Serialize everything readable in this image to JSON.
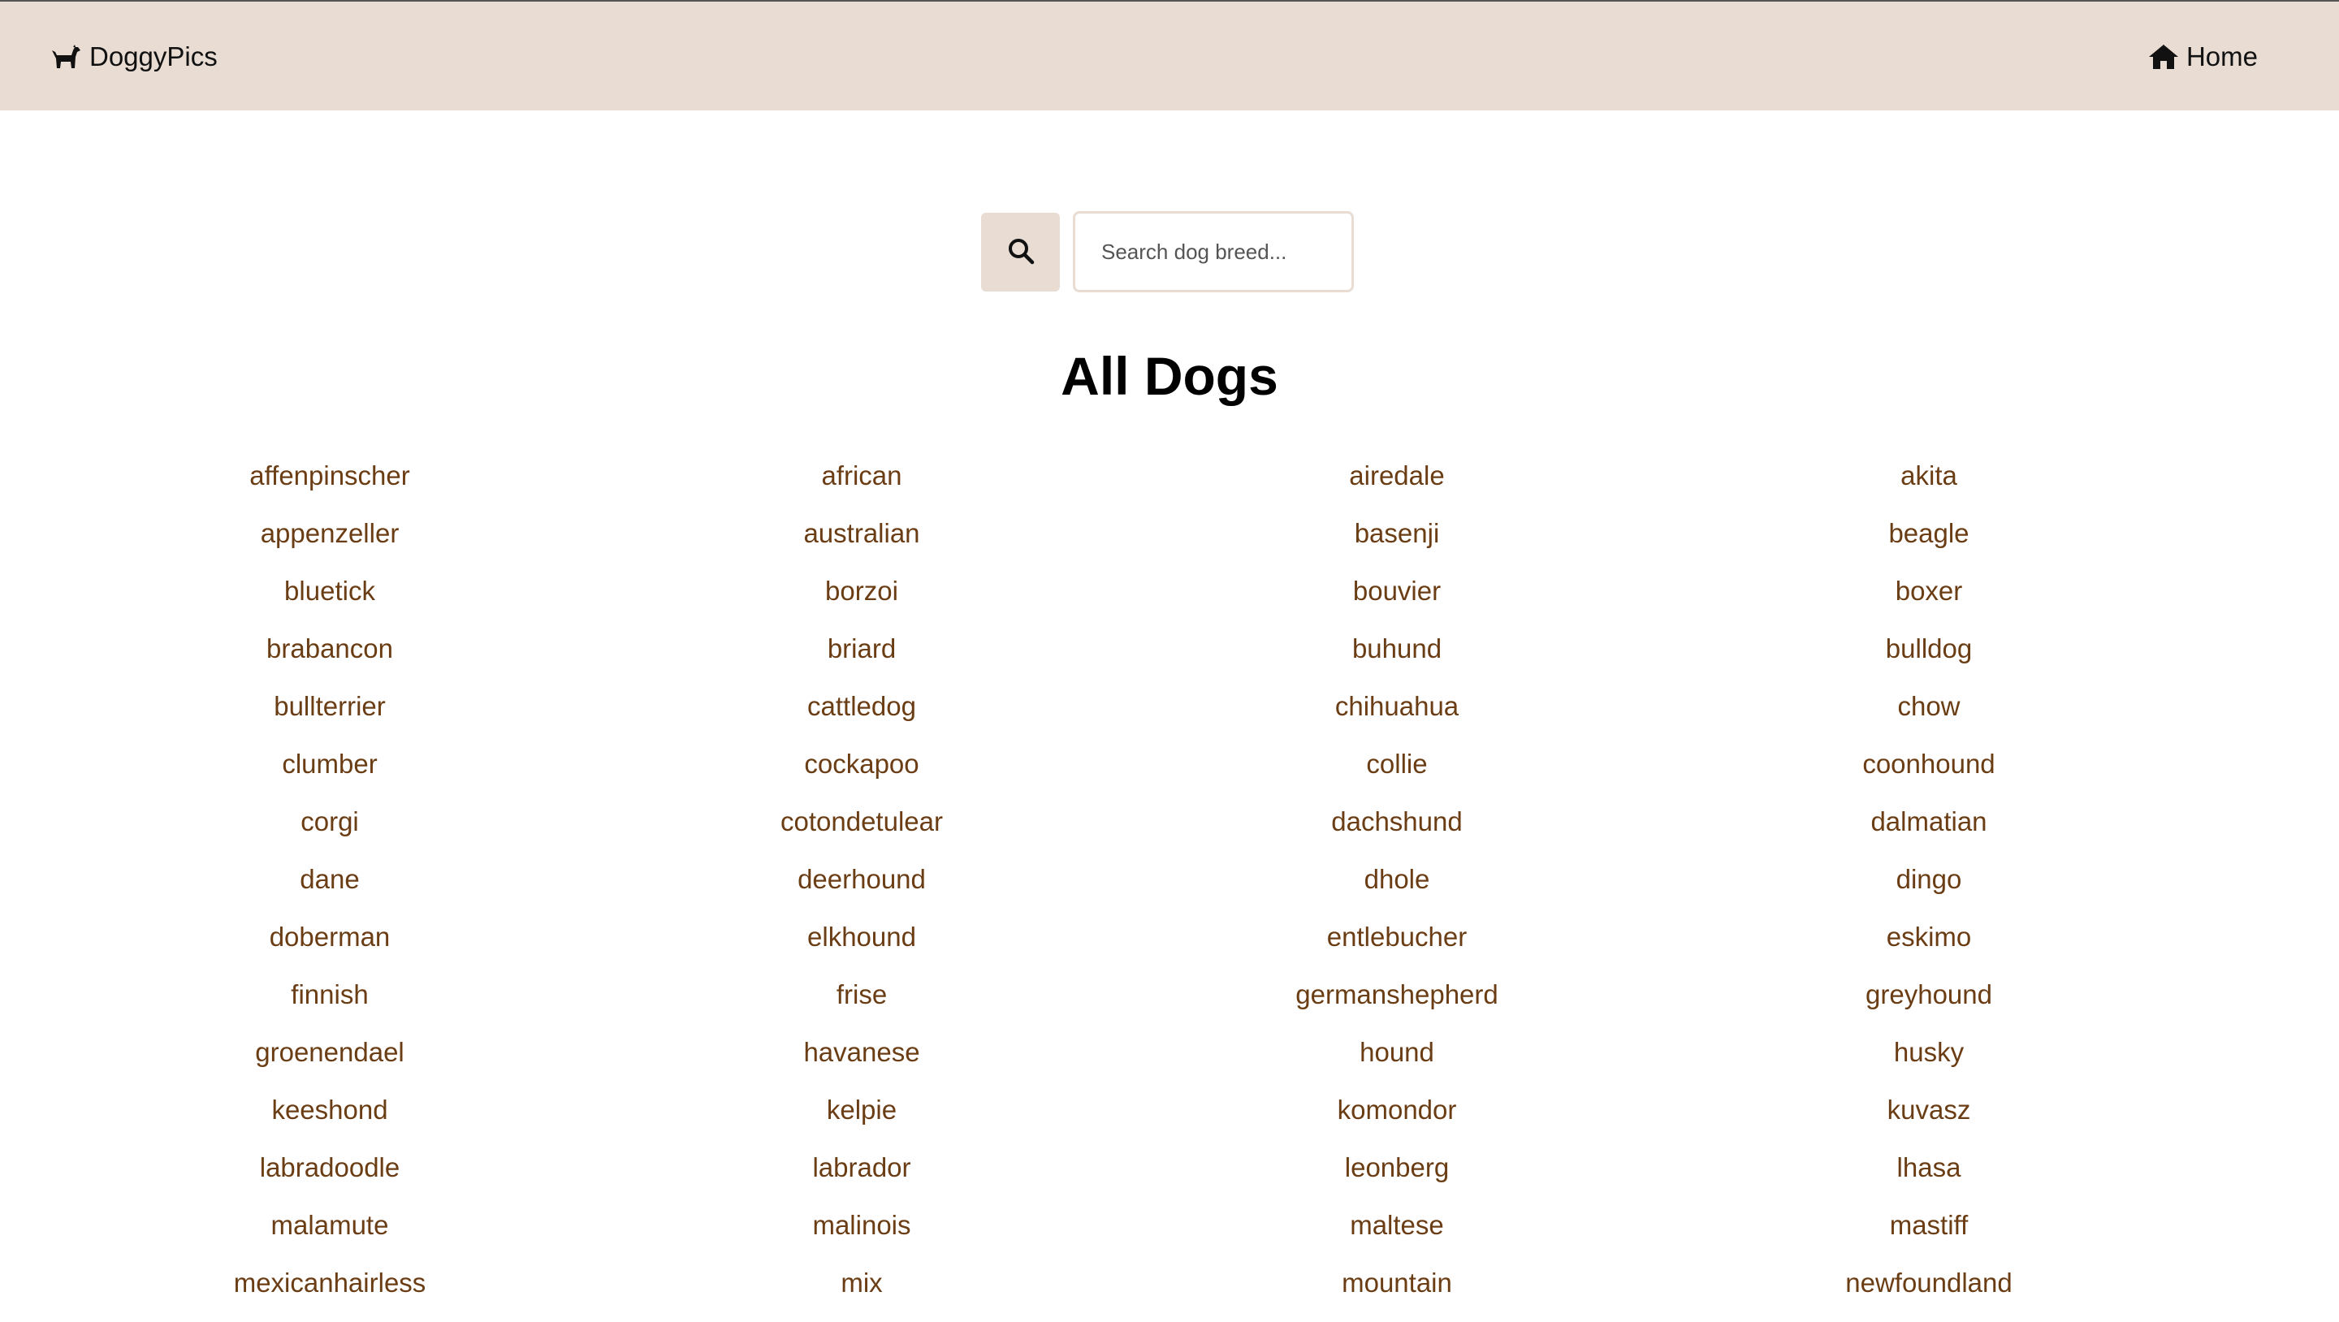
{
  "navbar": {
    "brand_label": "DoggyPics",
    "brand_icon": "dog-icon",
    "home_label": "Home",
    "home_icon": "home-icon",
    "background_color": "#e8dcd3"
  },
  "search": {
    "button_icon": "search-icon",
    "placeholder": "Search dog breed...",
    "value": ""
  },
  "page": {
    "title": "All Dogs"
  },
  "breeds": [
    "affenpinscher",
    "african",
    "airedale",
    "akita",
    "appenzeller",
    "australian",
    "basenji",
    "beagle",
    "bluetick",
    "borzoi",
    "bouvier",
    "boxer",
    "brabancon",
    "briard",
    "buhund",
    "bulldog",
    "bullterrier",
    "cattledog",
    "chihuahua",
    "chow",
    "clumber",
    "cockapoo",
    "collie",
    "coonhound",
    "corgi",
    "cotondetulear",
    "dachshund",
    "dalmatian",
    "dane",
    "deerhound",
    "dhole",
    "dingo",
    "doberman",
    "elkhound",
    "entlebucher",
    "eskimo",
    "finnish",
    "frise",
    "germanshepherd",
    "greyhound",
    "groenendael",
    "havanese",
    "hound",
    "husky",
    "keeshond",
    "kelpie",
    "komondor",
    "kuvasz",
    "labradoodle",
    "labrador",
    "leonberg",
    "lhasa",
    "malamute",
    "malinois",
    "maltese",
    "mastiff",
    "mexicanhairless",
    "mix",
    "mountain",
    "newfoundland"
  ],
  "colors": {
    "breed_link": "#6b3d14",
    "accent": "#e8dcd3"
  }
}
